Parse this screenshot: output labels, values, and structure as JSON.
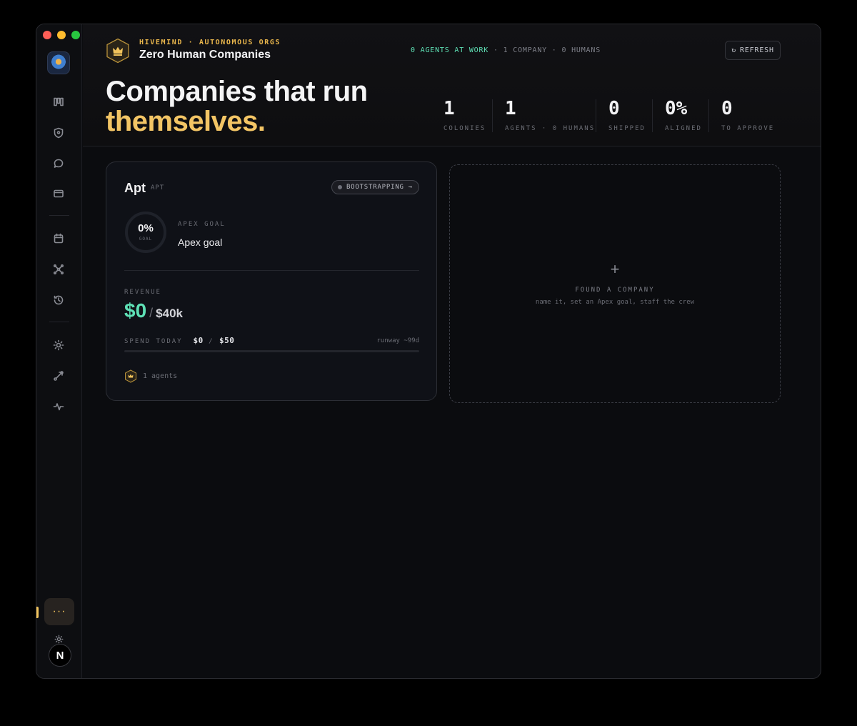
{
  "header": {
    "kicker": "HIVEMIND · AUTONOMOUS ORGS",
    "title": "Zero Human Companies",
    "status_agents": "0 AGENTS AT WORK",
    "status_rest": " · 1 COMPANY · 0 HUMANS",
    "refresh_icon": "↻",
    "refresh_label": "REFRESH",
    "brand_icon": "crown-icon"
  },
  "hero": {
    "line1": "Companies that run",
    "line2": "themselves."
  },
  "stats": [
    {
      "value": "1",
      "label": "COLONIES"
    },
    {
      "value": "1",
      "label": "AGENTS · 0 HUMANS"
    },
    {
      "value": "0",
      "label": "SHIPPED"
    },
    {
      "value": "0%",
      "label": "ALIGNED"
    },
    {
      "value": "0",
      "label": "TO APPROVE"
    }
  ],
  "company_card": {
    "name": "Apt",
    "ticker": "APT",
    "status": "BOOTSTRAPPING",
    "status_arrow": "→",
    "goal_progress": "0%",
    "goal_progress_fraction": 0,
    "goal_ring_label": "GOAL",
    "goal_kicker": "APEX GOAL",
    "goal_text": "Apex goal",
    "revenue_kicker": "REVENUE",
    "revenue_current": "$0",
    "revenue_slash": "/",
    "revenue_target": "$40k",
    "spend_kicker": "SPEND TODAY",
    "spend_current": "$0",
    "spend_slash": "/",
    "spend_limit": "$50",
    "spend_fraction": 0,
    "runway": "runway ~99d",
    "agents": "1 agents"
  },
  "found_company": {
    "plus": "+",
    "title": "FOUND A COMPANY",
    "subtitle": "name it, set an Apex goal, staff the crew"
  },
  "sidebar": {
    "more_label": "···",
    "avatar_letter": "N",
    "icons": [
      "board-icon",
      "shield-icon",
      "chat-icon",
      "wallet-icon",
      "calendar-icon",
      "network-icon",
      "history-icon",
      "settings-sun-icon",
      "link-icon",
      "activity-icon",
      "theme-sun-icon"
    ]
  },
  "colors": {
    "accent_gold": "#f3c565",
    "accent_green": "#5ee0b5",
    "background": "#0b0c0f"
  }
}
